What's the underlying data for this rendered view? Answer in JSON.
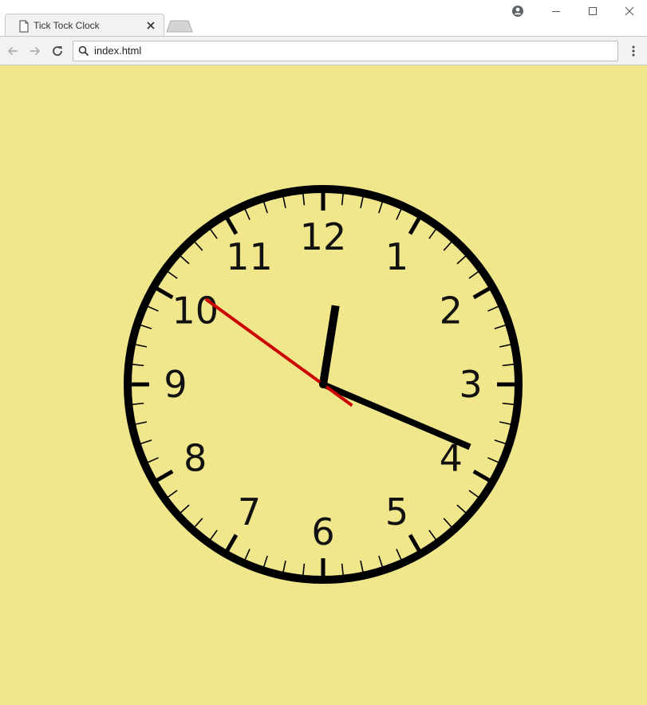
{
  "browser": {
    "tab": {
      "title": "Tick Tock Clock",
      "page_icon": "page-icon",
      "close_icon": "close-icon"
    },
    "new_tab_icon": "new-tab-icon",
    "window_controls": [
      "profile-icon",
      "minimize-icon",
      "maximize-icon",
      "close-icon"
    ],
    "nav": [
      "back-arrow-icon",
      "forward-arrow-icon",
      "reload-icon"
    ],
    "address": {
      "icon": "search-icon",
      "value": "index.html"
    },
    "menu_icon": "kebab-menu-icon"
  },
  "page": {
    "background": "#f0e68c",
    "clock": {
      "numerals": [
        "12",
        "1",
        "2",
        "3",
        "4",
        "5",
        "6",
        "7",
        "8",
        "9",
        "10",
        "11"
      ],
      "time": {
        "hours": 12,
        "minutes": 18,
        "seconds": 51
      },
      "colors": {
        "face": "#f0e68c",
        "rim": "#000000",
        "hands": "#000000",
        "second_hand": "#cc0000"
      }
    }
  }
}
